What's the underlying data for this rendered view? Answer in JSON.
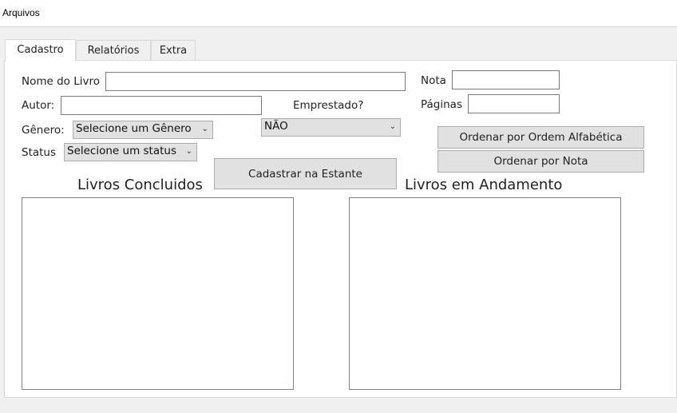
{
  "menu": {
    "arquivos": "Arquivos"
  },
  "tabs": [
    "Cadastro",
    "Relatórios",
    "Extra"
  ],
  "form": {
    "nome_label": "Nome do Livro",
    "autor_label": "Autor:",
    "genero_label": "Gênero:",
    "genero_selected": "Selecione um Gênero",
    "status_label": "Status",
    "status_selected": "Selecione um status",
    "emprestado_label": "Emprestado?",
    "emprestado_selected": "NÃO",
    "nota_label": "Nota",
    "paginas_label": "Páginas"
  },
  "buttons": {
    "cadastrar": "Cadastrar na Estante",
    "ordenar_alfabetica": "Ordenar por Ordem Alfabética",
    "ordenar_nota": "Ordenar por Nota"
  },
  "lists": {
    "concluidos_title": "Livros Concluidos",
    "andamento_title": "Livros em Andamento"
  },
  "icons": {
    "dropdown": "chevron-down-icon"
  }
}
